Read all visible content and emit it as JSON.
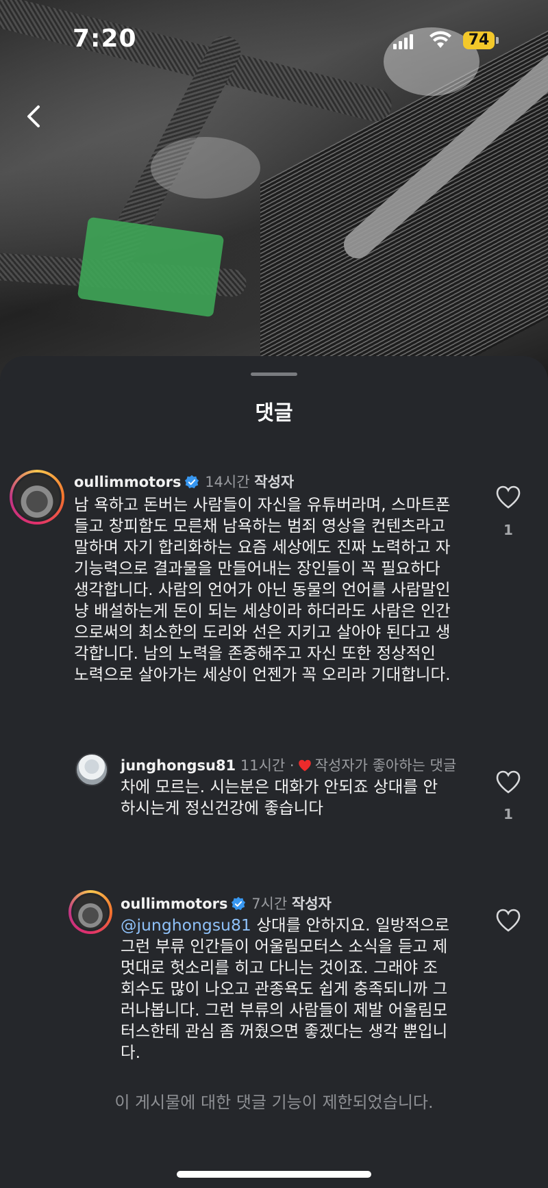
{
  "status_bar": {
    "time": "7:20",
    "battery": "74"
  },
  "sheet": {
    "title": "댓글",
    "disabled_note": "이 게시물에 대한 댓글 기능이 제한되었습니다."
  },
  "comments": [
    {
      "username": "oullimmotors",
      "time": "14시간",
      "author_label": "작성자",
      "text": "남 욕하고 돈버는 사람들이 자신을 유튜버라며, 스마트폰\n들고 창피함도 모른채 남욕하는 범죄 영상을 컨텐츠라고\n말하며 자기 합리화하는 요즘 세상에도 진짜 노력하고 자\n기능력으로 결과물을 만들어내는 장인들이 꼭 필요하다\n생각합니다. 사람의 언어가 아닌 동물의 언어를 사람말인\n냥 배설하는게 돈이 되는 세상이라 하더라도 사람은 인간\n으로써의 최소한의 도리와 선은 지키고 살아야 된다고 생\n각합니다. 남의 노력을 존중해주고 자신 또한 정상적인\n노력으로 살아가는 세상이 언젠가 꼭 오리라 기대합니다.",
      "likes": "1"
    },
    {
      "username": "junghongsu81",
      "time": "11시간",
      "separator": "·",
      "liked_by_author": "작성자가 좋아하는 댓글",
      "text": "차에 모르는. 시는분은 대화가 안되죠 상대를 안\n하시는게 정신건강에 좋습니다",
      "likes": "1"
    },
    {
      "username": "oullimmotors",
      "time": "7시간",
      "author_label": "작성자",
      "mention": "@junghongsu81",
      "text": " 상대를 안하지요. 일방적으로\n그런 부류 인간들이 어울림모터스 소식을 듣고 제\n멋대로 헛소리를 히고 다니는 것이죠. 그래야 조\n회수도 많이 나오고 관종욕도 쉽게 충족되니까 그\n러나봅니다. 그런 부류의 사람들이 제발 어울림모\n터스한테 관심 좀 꺼줬으면 좋겠다는 생각 뿐입니\n다."
    }
  ],
  "colors": {
    "sheet_bg": "#25272b",
    "verified": "#3897f0",
    "mention": "#8ec0f7",
    "heart": "#ed2b2b",
    "battery": "#f3c82a"
  },
  "icons": [
    "back-chevron-icon",
    "signal-icon",
    "wifi-icon",
    "battery-icon",
    "verified-badge-icon",
    "heart-icon"
  ]
}
